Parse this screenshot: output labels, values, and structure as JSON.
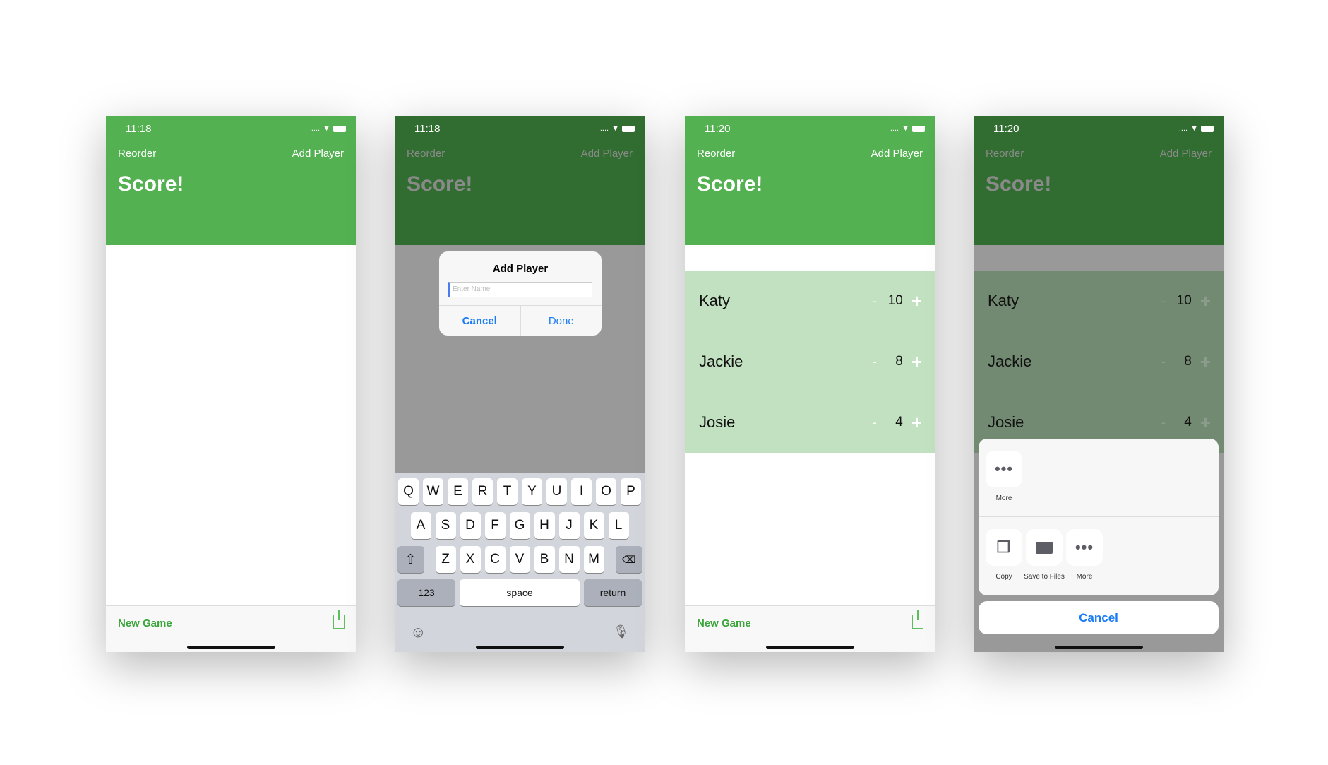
{
  "app": {
    "reorder": "Reorder",
    "add_player": "Add Player",
    "title": "Score!",
    "new_game": "New Game"
  },
  "screens": [
    {
      "time": "11:18"
    },
    {
      "time": "11:18",
      "dialog": {
        "title": "Add Player",
        "placeholder": "Enter Name",
        "cancel": "Cancel",
        "done": "Done"
      },
      "keyboard": {
        "row1": [
          "Q",
          "W",
          "E",
          "R",
          "T",
          "Y",
          "U",
          "I",
          "O",
          "P"
        ],
        "row2": [
          "A",
          "S",
          "D",
          "F",
          "G",
          "H",
          "J",
          "K",
          "L"
        ],
        "row3": [
          "Z",
          "X",
          "C",
          "V",
          "B",
          "N",
          "M"
        ],
        "numbers": "123",
        "space": "space",
        "return": "return"
      }
    },
    {
      "time": "11:20"
    },
    {
      "time": "11:20",
      "share": {
        "top_item": "More",
        "items": [
          "Copy",
          "Save to Files",
          "More"
        ],
        "cancel": "Cancel"
      }
    }
  ],
  "players": [
    {
      "name": "Katy",
      "score": "10"
    },
    {
      "name": "Jackie",
      "score": "8"
    },
    {
      "name": "Josie",
      "score": "4"
    }
  ],
  "controls": {
    "minus": "-",
    "plus": "+"
  },
  "colors": {
    "header": "#53b151",
    "row_bg": "#c2e1c1",
    "accent": "#1a7cf5"
  }
}
